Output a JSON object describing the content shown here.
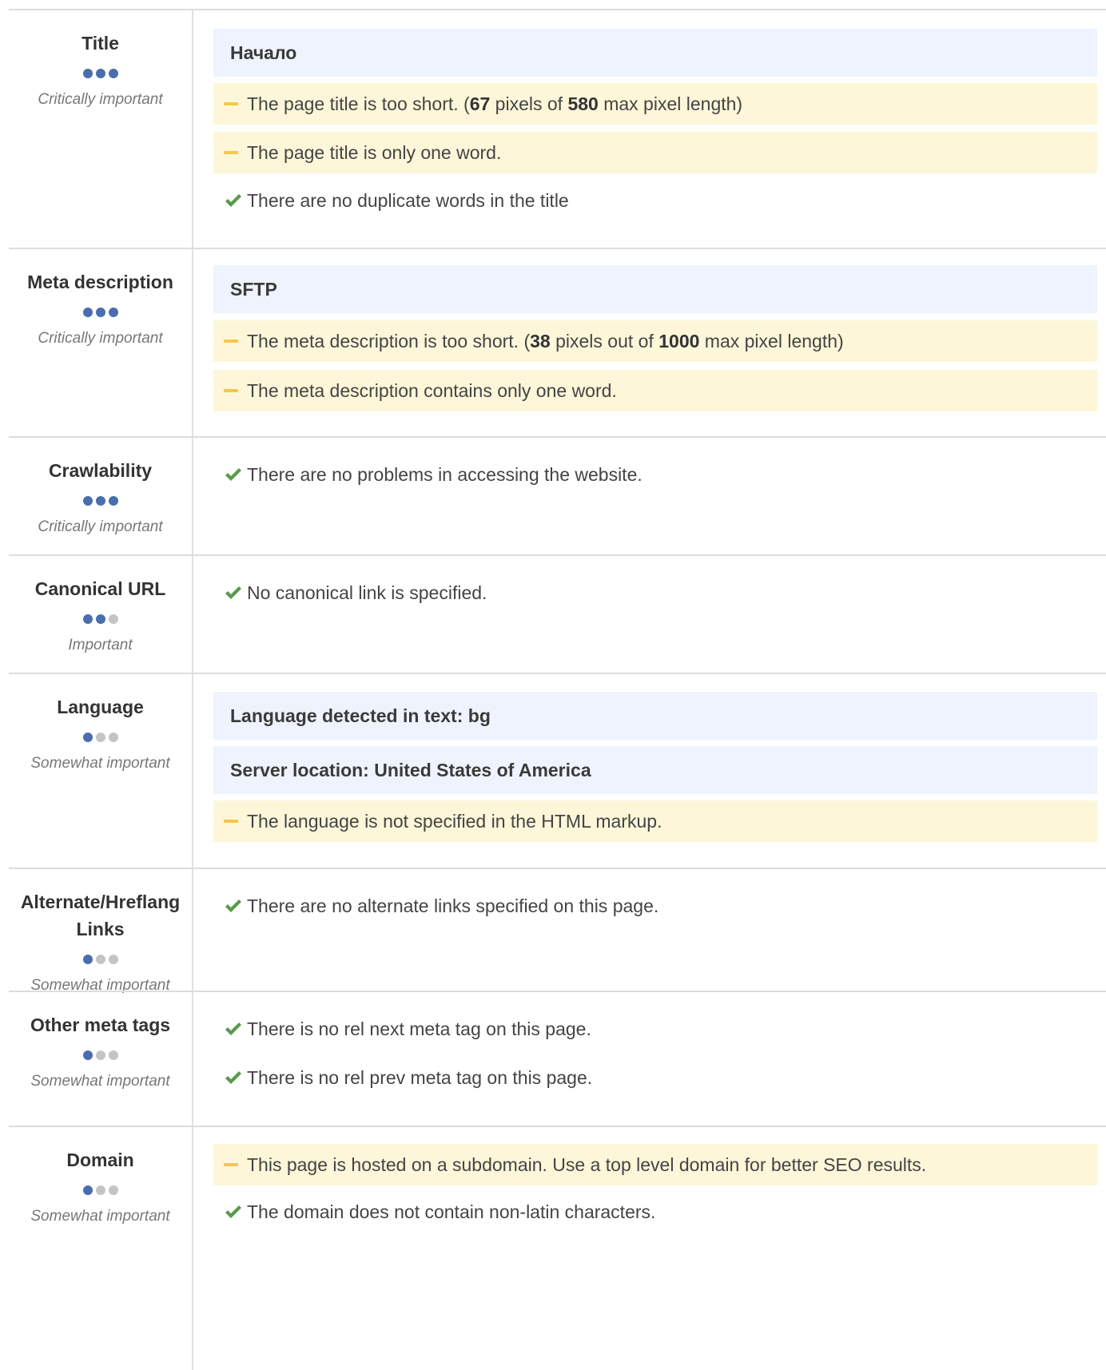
{
  "sections": [
    {
      "title": "Title",
      "importance": "Critically important",
      "level": 3,
      "items": [
        {
          "type": "info",
          "text": "Начало"
        },
        {
          "type": "warn",
          "parts": [
            "The page title is too short. (",
            "67",
            " pixels of ",
            "580",
            " max pixel length)"
          ]
        },
        {
          "type": "warn",
          "text": "The page title is only one word."
        },
        {
          "type": "ok",
          "text": "There are no duplicate words in the title"
        }
      ]
    },
    {
      "title": "Meta description",
      "importance": "Critically important",
      "level": 3,
      "items": [
        {
          "type": "info",
          "text": "SFTP"
        },
        {
          "type": "warn",
          "parts": [
            "The meta description is too short. (",
            "38",
            " pixels out of ",
            "1000",
            " max pixel length)"
          ]
        },
        {
          "type": "warn",
          "text": "The meta description contains only one word."
        }
      ]
    },
    {
      "title": "Crawlability",
      "importance": "Critically important",
      "level": 3,
      "items": [
        {
          "type": "ok",
          "text": "There are no problems in accessing the website."
        }
      ]
    },
    {
      "title": "Canonical URL",
      "importance": "Important",
      "level": 2,
      "items": [
        {
          "type": "ok",
          "text": "No canonical link is specified."
        }
      ]
    },
    {
      "title": "Language",
      "importance": "Somewhat important",
      "level": 1,
      "items": [
        {
          "type": "info",
          "text": "Language detected in text: bg"
        },
        {
          "type": "info",
          "text": "Server location: United States of America"
        },
        {
          "type": "warn",
          "text": "The language is not specified in the HTML markup."
        }
      ]
    },
    {
      "title": "Alternate/Hreflang Links",
      "title_lines": [
        "Alternate/Hreflang",
        "Links"
      ],
      "importance": "Somewhat important",
      "level": 1,
      "items": [
        {
          "type": "ok",
          "text": "There are no alternate links specified on this page."
        }
      ]
    },
    {
      "title": "Other meta tags",
      "importance": "Somewhat important",
      "level": 1,
      "items": [
        {
          "type": "ok",
          "text": "There is no rel next meta tag on this page."
        },
        {
          "type": "ok",
          "text": "There is no rel prev meta tag on this page."
        }
      ]
    },
    {
      "title": "Domain",
      "importance": "Somewhat important",
      "level": 1,
      "items": [
        {
          "type": "warn",
          "text": "This page is hosted on a subdomain. Use a top level domain for better SEO results."
        },
        {
          "type": "ok",
          "text": "The domain does not contain non-latin characters."
        }
      ]
    }
  ],
  "colors": {
    "info_bg": "#eef3fd",
    "warn_bg": "#fdf6d9",
    "warn_marker": "#f3c945",
    "ok_marker": "#5a9a4c",
    "dot_on": "#4a6dae",
    "dot_off": "#c4c4c4"
  }
}
